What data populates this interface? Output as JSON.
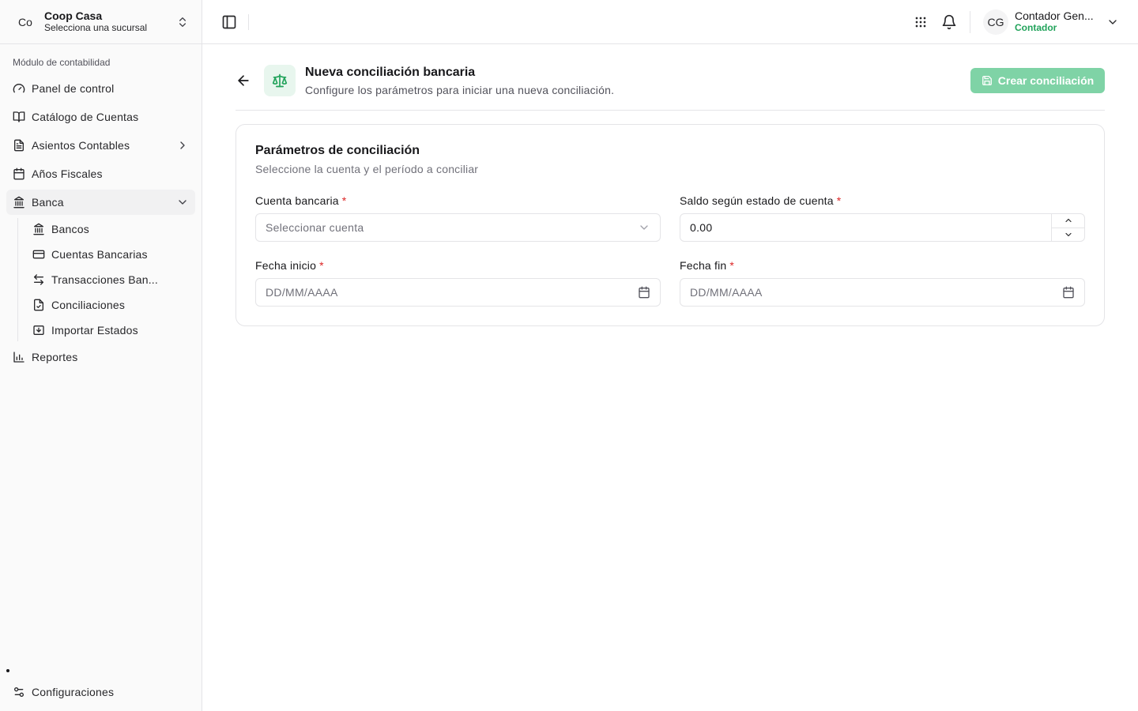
{
  "org": {
    "initials": "Co",
    "name": "Coop Casa",
    "subtitle": "Selecciona una sucursal"
  },
  "sidebar": {
    "section_label": "Módulo de contabilidad",
    "items": [
      {
        "label": "Panel de control",
        "icon": "gauge-icon"
      },
      {
        "label": "Catálogo de Cuentas",
        "icon": "book-open-icon"
      },
      {
        "label": "Asientos Contables",
        "icon": "file-text-icon",
        "expandable": true
      },
      {
        "label": "Años Fiscales",
        "icon": "calendar-icon"
      },
      {
        "label": "Banca",
        "icon": "landmark-icon",
        "expanded": true
      }
    ],
    "banca_children": [
      {
        "label": "Bancos",
        "icon": "landmark-icon"
      },
      {
        "label": "Cuentas Bancarias",
        "icon": "credit-card-icon"
      },
      {
        "label": "Transacciones Ban...",
        "icon": "arrow-left-right-icon"
      },
      {
        "label": "Conciliaciones",
        "icon": "file-check-icon"
      },
      {
        "label": "Importar Estados",
        "icon": "import-icon"
      }
    ],
    "reports": {
      "label": "Reportes",
      "icon": "bar-chart-icon"
    },
    "settings": {
      "label": "Configuraciones",
      "icon": "settings-sliders-icon"
    }
  },
  "header": {
    "user": {
      "initials": "CG",
      "name": "Contador Gen...",
      "role": "Contador"
    }
  },
  "page": {
    "title": "Nueva conciliación bancaria",
    "subtitle": "Configure los parámetros para iniciar una nueva conciliación.",
    "create_button": "Crear conciliación"
  },
  "card": {
    "title": "Parámetros de conciliación",
    "subtitle": "Seleccione la cuenta y el período a conciliar",
    "fields": {
      "cuenta": {
        "label": "Cuenta bancaria",
        "required": "*",
        "placeholder": "Seleccionar cuenta"
      },
      "saldo": {
        "label": "Saldo según estado de cuenta",
        "required": "*",
        "value": "0.00"
      },
      "inicio": {
        "label": "Fecha inicio",
        "required": "*",
        "placeholder": "DD/MM/AAAA"
      },
      "fin": {
        "label": "Fecha fin",
        "required": "*",
        "placeholder": "DD/MM/AAAA"
      }
    }
  },
  "colors": {
    "accent": "#22a35b",
    "accent_soft": "#e8f6ee",
    "button_disabled": "#7fd3a6",
    "required": "#dc2626"
  }
}
